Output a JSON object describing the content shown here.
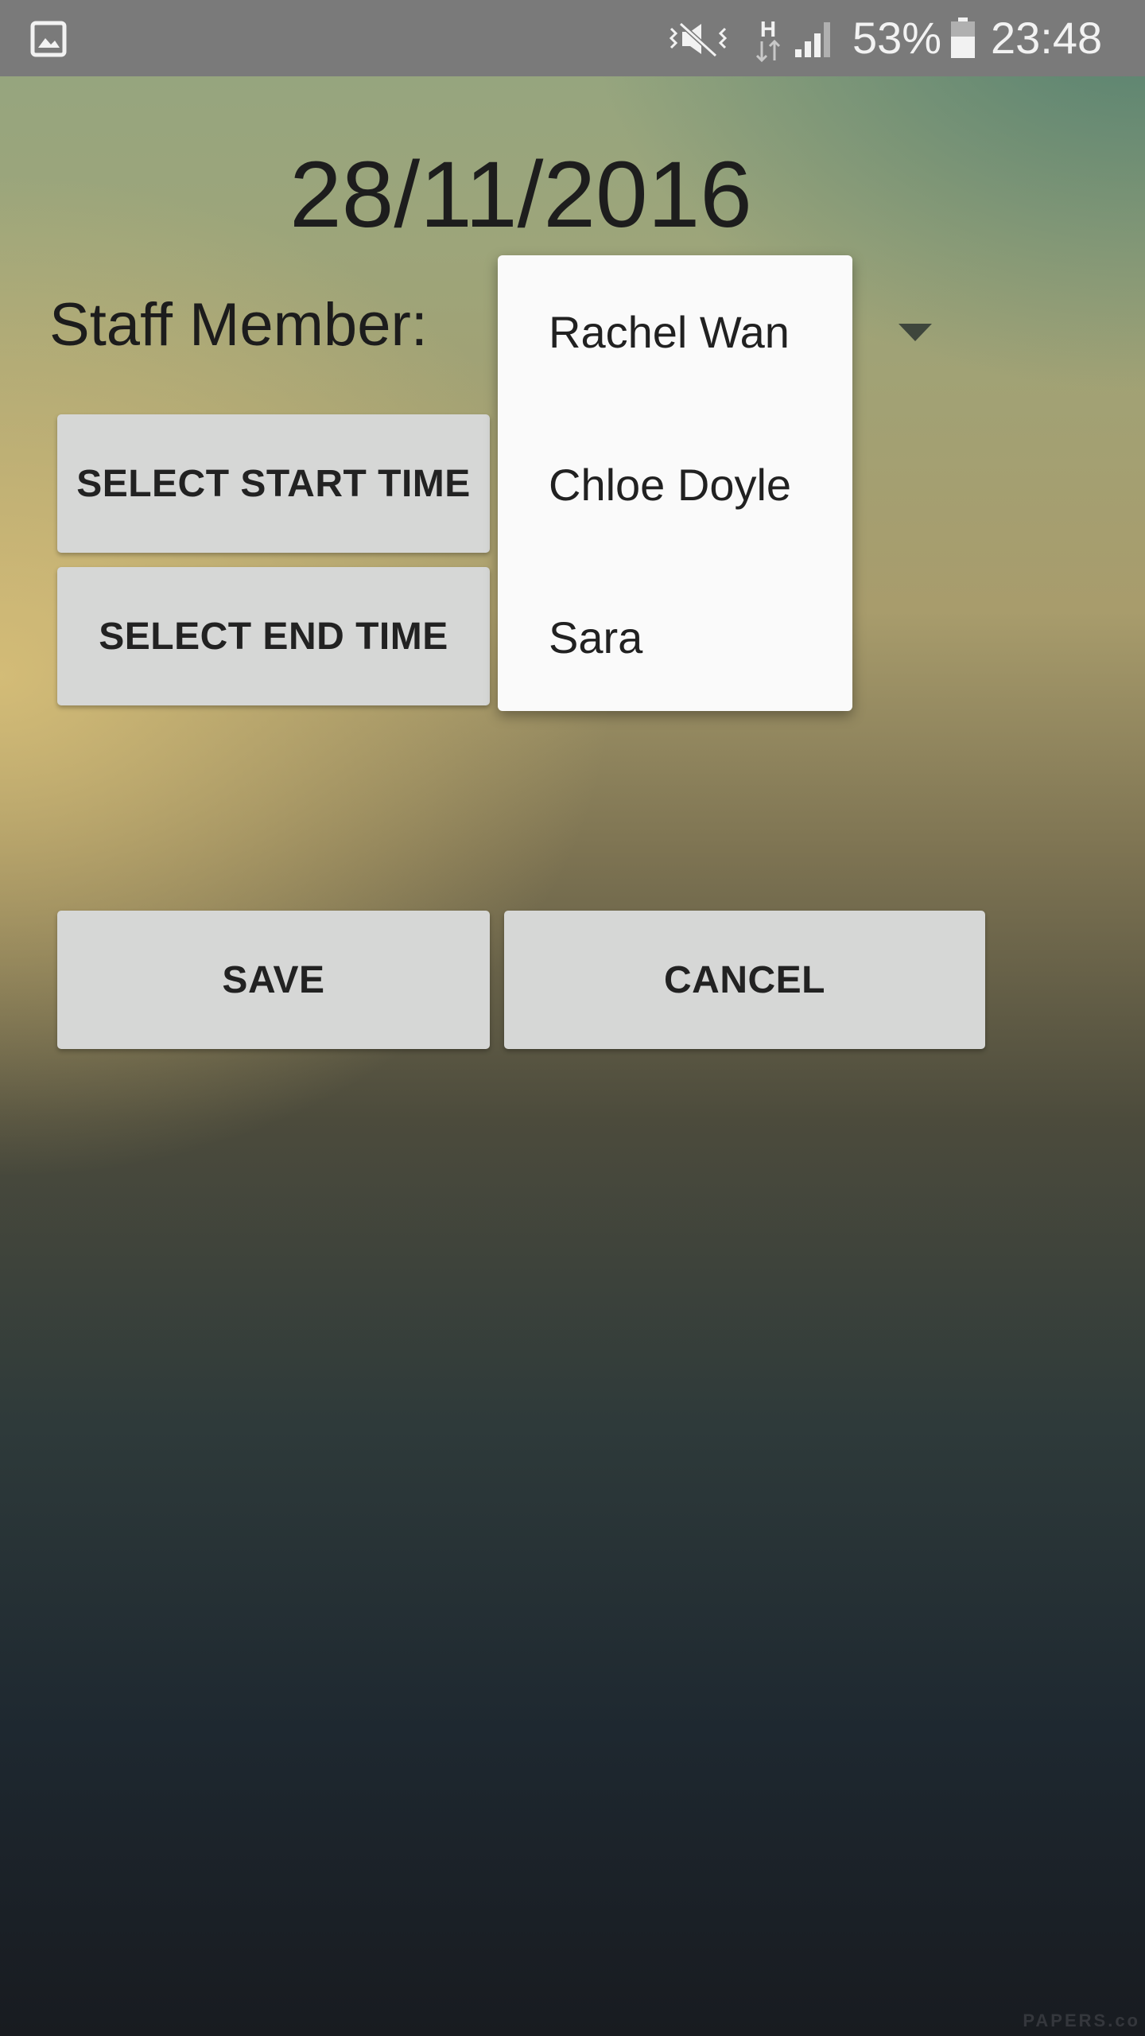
{
  "status_bar": {
    "icons": [
      "gallery-icon",
      "mute-vibrate-icon",
      "hspa-data-icon",
      "signal-icon",
      "battery-icon"
    ],
    "battery_percent": "53%",
    "clock": "23:48"
  },
  "form": {
    "date": "28/11/2016",
    "staff_label": "Staff Member:",
    "start_time_button": "SELECT START TIME",
    "end_time_button": "SELECT END TIME",
    "save_button": "SAVE",
    "cancel_button": "CANCEL"
  },
  "staff_dropdown": {
    "options": [
      "Rachel Wan",
      "Chloe Doyle",
      "Sara"
    ]
  },
  "watermark": "PAPERS.co",
  "colors": {
    "status_bar_bg": "#7a7a7a",
    "button_bg": "#d6d7d6",
    "dropdown_bg": "#fafafa",
    "text_dark": "#1d1d1d"
  }
}
